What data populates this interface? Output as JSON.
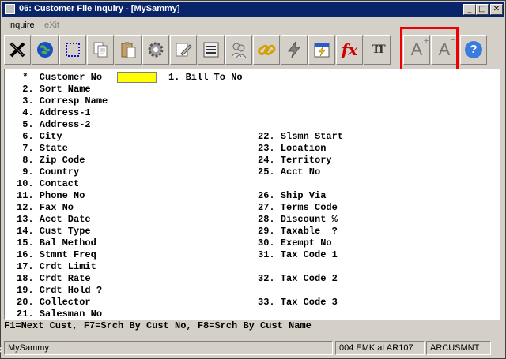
{
  "window": {
    "title": "06: Customer File Inquiry - [MySammy]"
  },
  "window_controls": {
    "minimize": "_",
    "maximize": "□",
    "close": "✕"
  },
  "menu": {
    "items": [
      "Inquire",
      "eXit"
    ]
  },
  "toolbar": {
    "buttons": [
      "close-tool-icon",
      "globe-icon",
      "select-box-icon",
      "copy-icon",
      "paste-icon",
      "gear-icon",
      "edit-icon",
      "list-icon",
      "users-icon",
      "link-icon",
      "lightning-icon",
      "calendar-icon",
      "function-icon",
      "font-icon",
      "font-larger-icon",
      "font-smaller-icon",
      "help-icon"
    ],
    "fx_label": "fx",
    "font_label": "TT",
    "font_larger_label": "A",
    "font_smaller_label": "A",
    "help_label": "?",
    "highlight_color": "#e00000"
  },
  "form": {
    "fields": [
      {
        "num": " *",
        "label": "Customer No",
        "col": 0,
        "row": 0
      },
      {
        "num": "1.",
        "label": "Bill To No",
        "col": 2,
        "row": 0
      },
      {
        "num": " 2.",
        "label": "Sort Name",
        "col": 0,
        "row": 1
      },
      {
        "num": " 3.",
        "label": "Corresp Name",
        "col": 0,
        "row": 2
      },
      {
        "num": " 4.",
        "label": "Address-1",
        "col": 0,
        "row": 3
      },
      {
        "num": " 5.",
        "label": "Address-2",
        "col": 0,
        "row": 4
      },
      {
        "num": " 6.",
        "label": "City",
        "col": 0,
        "row": 5
      },
      {
        "num": " 7.",
        "label": "State",
        "col": 0,
        "row": 6
      },
      {
        "num": " 8.",
        "label": "Zip Code",
        "col": 0,
        "row": 7
      },
      {
        "num": " 9.",
        "label": "Country",
        "col": 0,
        "row": 8
      },
      {
        "num": "10.",
        "label": "Contact",
        "col": 0,
        "row": 9
      },
      {
        "num": "11.",
        "label": "Phone No",
        "col": 0,
        "row": 10
      },
      {
        "num": "12.",
        "label": "Fax No",
        "col": 0,
        "row": 11
      },
      {
        "num": "13.",
        "label": "Acct Date",
        "col": 0,
        "row": 12
      },
      {
        "num": "14.",
        "label": "Cust Type",
        "col": 0,
        "row": 13
      },
      {
        "num": "15.",
        "label": "Bal Method",
        "col": 0,
        "row": 14
      },
      {
        "num": "16.",
        "label": "Stmnt Freq",
        "col": 0,
        "row": 15
      },
      {
        "num": "17.",
        "label": "Crdt Limit",
        "col": 0,
        "row": 16
      },
      {
        "num": "18.",
        "label": "Crdt Rate",
        "col": 0,
        "row": 17
      },
      {
        "num": "19.",
        "label": "Crdt Hold ?",
        "col": 0,
        "row": 18
      },
      {
        "num": "20.",
        "label": "Collector",
        "col": 0,
        "row": 19
      },
      {
        "num": "21.",
        "label": "Salesman No",
        "col": 0,
        "row": 20
      },
      {
        "num": "22.",
        "label": "Slsmn Start",
        "col": 1,
        "row": 5
      },
      {
        "num": "23.",
        "label": "Location",
        "col": 1,
        "row": 6
      },
      {
        "num": "24.",
        "label": "Territory",
        "col": 1,
        "row": 7
      },
      {
        "num": "25.",
        "label": "Acct No",
        "col": 1,
        "row": 8
      },
      {
        "num": "26.",
        "label": "Ship Via",
        "col": 1,
        "row": 10
      },
      {
        "num": "27.",
        "label": "Terms Code",
        "col": 1,
        "row": 11
      },
      {
        "num": "28.",
        "label": "Discount %",
        "col": 1,
        "row": 12
      },
      {
        "num": "29.",
        "label": "Taxable  ?",
        "col": 1,
        "row": 13
      },
      {
        "num": "30.",
        "label": "Exempt No",
        "col": 1,
        "row": 14
      },
      {
        "num": "31.",
        "label": "Tax Code 1",
        "col": 1,
        "row": 15
      },
      {
        "num": "32.",
        "label": "Tax Code 2",
        "col": 1,
        "row": 17
      },
      {
        "num": "33.",
        "label": "Tax Code 3",
        "col": 1,
        "row": 19
      }
    ],
    "customer_no_value": ""
  },
  "function_keys": "F1=Next Cust, F7=Srch By Cust No, F8=Srch By Cust Name",
  "status": {
    "left": "MySammy",
    "user": "004 EMK at AR107",
    "program": "ARCUSMNT"
  }
}
